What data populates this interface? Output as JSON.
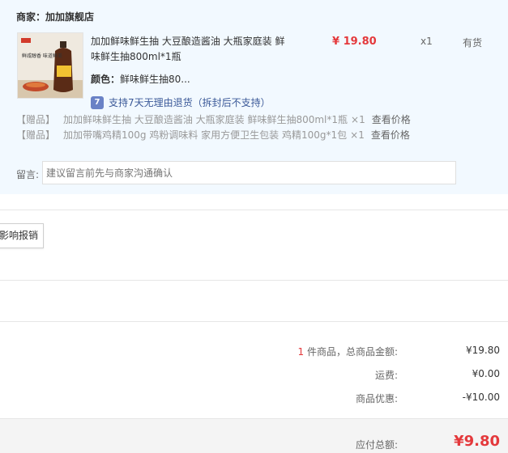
{
  "seller": {
    "label": "商家：加加旗舰店"
  },
  "product": {
    "title_line1": "加加鲜味鲜生抽 大豆酿造酱油 大瓶家庭装 鲜",
    "title_line2": "味鲜生抽800ml*1瓶",
    "thumb_text": "鲜咸醇香 味道鲜美",
    "price": "¥ 19.80",
    "quantity": "x1",
    "stock": "有货",
    "color_label": "颜色：",
    "color_value": "鲜味鲜生抽80...",
    "return_icon": "7",
    "return_text": "支持7天无理由退货（拆封后不支持）"
  },
  "gifts": [
    {
      "tag": "【赠品】",
      "name": "加加鲜味鲜生抽 大豆酿造酱油 大瓶家庭装 鲜味鲜生抽800ml*1瓶",
      "qty": "×1",
      "link": "查看价格"
    },
    {
      "tag": "【赠品】",
      "name": "加加带嘴鸡精100g 鸡粉调味料 家用方便卫生包装 鸡精100g*1包",
      "qty": "×1",
      "link": "查看价格"
    }
  ],
  "memo": {
    "label": "留言:",
    "placeholder": "建议留言前先与商家沟通确认"
  },
  "invoice": {
    "button_label": "影响报销"
  },
  "summary": {
    "item_count": "1",
    "items_label": " 件商品，总商品金额:",
    "items_value": "¥19.80",
    "shipping_label": "运费:",
    "shipping_value": "¥0.00",
    "discount_label": "商品优惠:",
    "discount_value": "-¥10.00"
  },
  "total": {
    "label": "应付总额:",
    "value": "¥9.80"
  },
  "colors": {
    "accent": "#e4393c",
    "panel": "#f2f9ff",
    "link": "#3b5998"
  }
}
